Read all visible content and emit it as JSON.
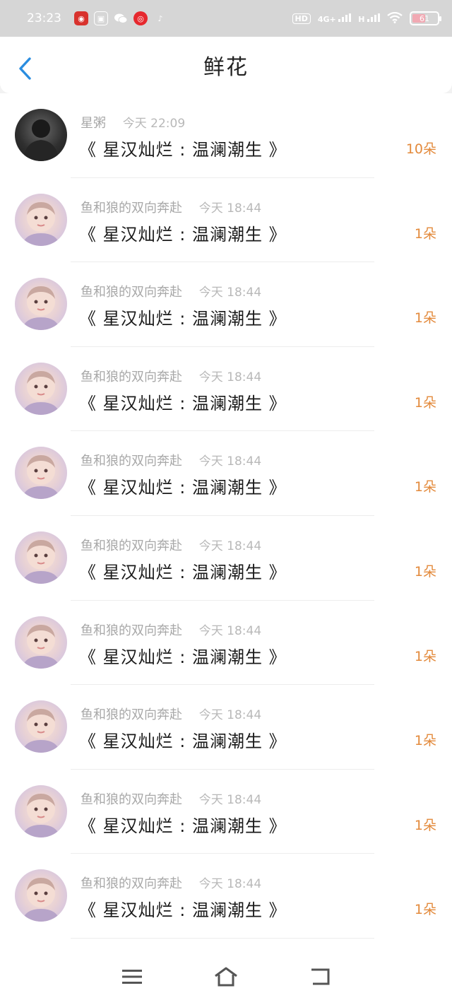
{
  "status_bar": {
    "time": "23:23",
    "network": "4G+",
    "signal_label": "H",
    "hd_label": "HD",
    "battery_level": "61"
  },
  "header": {
    "title": "鲜花"
  },
  "items": [
    {
      "name": "星粥",
      "time": "今天 22:09",
      "title": "《 星汉灿烂 : 温澜潮生 》",
      "count": "10朵",
      "avatar": "dark"
    },
    {
      "name": "鱼和狼的双向奔赴",
      "time": "今天 18:44",
      "title": "《 星汉灿烂 : 温澜潮生 》",
      "count": "1朵",
      "avatar": "kid"
    },
    {
      "name": "鱼和狼的双向奔赴",
      "time": "今天 18:44",
      "title": "《 星汉灿烂 : 温澜潮生 》",
      "count": "1朵",
      "avatar": "kid"
    },
    {
      "name": "鱼和狼的双向奔赴",
      "time": "今天 18:44",
      "title": "《 星汉灿烂 : 温澜潮生 》",
      "count": "1朵",
      "avatar": "kid"
    },
    {
      "name": "鱼和狼的双向奔赴",
      "time": "今天 18:44",
      "title": "《 星汉灿烂 : 温澜潮生 》",
      "count": "1朵",
      "avatar": "kid"
    },
    {
      "name": "鱼和狼的双向奔赴",
      "time": "今天 18:44",
      "title": "《 星汉灿烂 : 温澜潮生 》",
      "count": "1朵",
      "avatar": "kid"
    },
    {
      "name": "鱼和狼的双向奔赴",
      "time": "今天 18:44",
      "title": "《 星汉灿烂 : 温澜潮生 》",
      "count": "1朵",
      "avatar": "kid"
    },
    {
      "name": "鱼和狼的双向奔赴",
      "time": "今天 18:44",
      "title": "《 星汉灿烂 : 温澜潮生 》",
      "count": "1朵",
      "avatar": "kid"
    },
    {
      "name": "鱼和狼的双向奔赴",
      "time": "今天 18:44",
      "title": "《 星汉灿烂 : 温澜潮生 》",
      "count": "1朵",
      "avatar": "kid"
    },
    {
      "name": "鱼和狼的双向奔赴",
      "time": "今天 18:44",
      "title": "《 星汉灿烂 : 温澜潮生 》",
      "count": "1朵",
      "avatar": "kid"
    }
  ],
  "colors": {
    "accent_back": "#2a8de0",
    "count": "#e38a3c"
  }
}
